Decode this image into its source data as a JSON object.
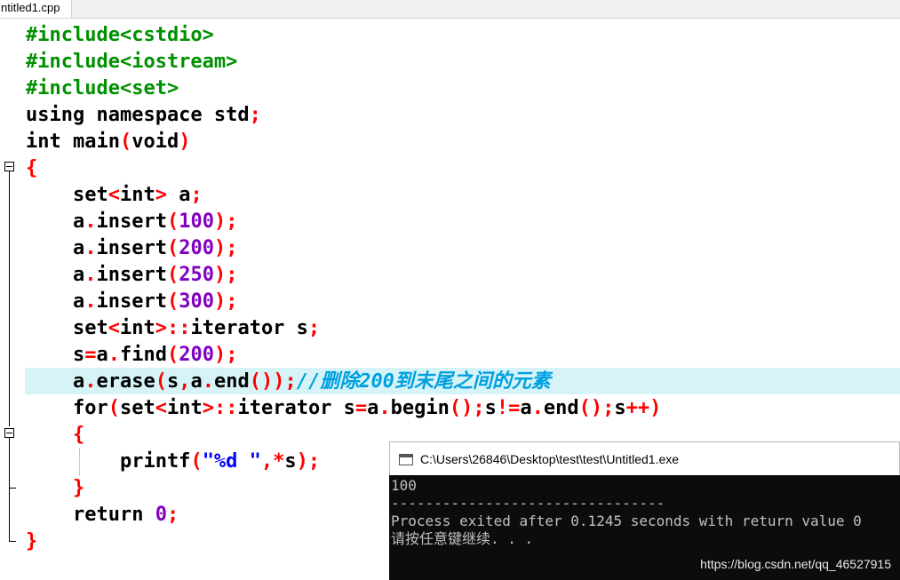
{
  "tab": {
    "label": "ntitled1.cpp"
  },
  "code_lines": [
    [
      {
        "t": "#include<cstdio>",
        "c": "pp"
      }
    ],
    [
      {
        "t": "#include<iostream>",
        "c": "pp"
      }
    ],
    [
      {
        "t": "#include<set>",
        "c": "pp"
      }
    ],
    [
      {
        "t": "using namespace ",
        "c": "kw"
      },
      {
        "t": "std",
        "c": "id"
      },
      {
        "t": ";",
        "c": "op"
      }
    ],
    [
      {
        "t": "int ",
        "c": "kw"
      },
      {
        "t": "main",
        "c": "id"
      },
      {
        "t": "(",
        "c": "op"
      },
      {
        "t": "void",
        "c": "kw"
      },
      {
        "t": ")",
        "c": "op"
      }
    ],
    [
      {
        "t": "{",
        "c": "op"
      }
    ],
    [
      {
        "t": "    set",
        "c": "id"
      },
      {
        "t": "<",
        "c": "op"
      },
      {
        "t": "int",
        "c": "kw"
      },
      {
        "t": "> ",
        "c": "op"
      },
      {
        "t": "a",
        "c": "id"
      },
      {
        "t": ";",
        "c": "op"
      }
    ],
    [
      {
        "t": "    a",
        "c": "id"
      },
      {
        "t": ".",
        "c": "op"
      },
      {
        "t": "insert",
        "c": "id"
      },
      {
        "t": "(",
        "c": "op"
      },
      {
        "t": "100",
        "c": "num"
      },
      {
        "t": ");",
        "c": "op"
      }
    ],
    [
      {
        "t": "    a",
        "c": "id"
      },
      {
        "t": ".",
        "c": "op"
      },
      {
        "t": "insert",
        "c": "id"
      },
      {
        "t": "(",
        "c": "op"
      },
      {
        "t": "200",
        "c": "num"
      },
      {
        "t": ");",
        "c": "op"
      }
    ],
    [
      {
        "t": "    a",
        "c": "id"
      },
      {
        "t": ".",
        "c": "op"
      },
      {
        "t": "insert",
        "c": "id"
      },
      {
        "t": "(",
        "c": "op"
      },
      {
        "t": "250",
        "c": "num"
      },
      {
        "t": ");",
        "c": "op"
      }
    ],
    [
      {
        "t": "    a",
        "c": "id"
      },
      {
        "t": ".",
        "c": "op"
      },
      {
        "t": "insert",
        "c": "id"
      },
      {
        "t": "(",
        "c": "op"
      },
      {
        "t": "300",
        "c": "num"
      },
      {
        "t": ");",
        "c": "op"
      }
    ],
    [
      {
        "t": "    set",
        "c": "id"
      },
      {
        "t": "<",
        "c": "op"
      },
      {
        "t": "int",
        "c": "kw"
      },
      {
        "t": ">::",
        "c": "op"
      },
      {
        "t": "iterator s",
        "c": "id"
      },
      {
        "t": ";",
        "c": "op"
      }
    ],
    [
      {
        "t": "    s",
        "c": "id"
      },
      {
        "t": "=",
        "c": "op"
      },
      {
        "t": "a",
        "c": "id"
      },
      {
        "t": ".",
        "c": "op"
      },
      {
        "t": "find",
        "c": "id"
      },
      {
        "t": "(",
        "c": "op"
      },
      {
        "t": "200",
        "c": "num"
      },
      {
        "t": ");",
        "c": "op"
      }
    ],
    [
      {
        "t": "    a",
        "c": "id"
      },
      {
        "t": ".",
        "c": "op"
      },
      {
        "t": "erase",
        "c": "id"
      },
      {
        "t": "(",
        "c": "op"
      },
      {
        "t": "s",
        "c": "id"
      },
      {
        "t": ",",
        "c": "op"
      },
      {
        "t": "a",
        "c": "id"
      },
      {
        "t": ".",
        "c": "op"
      },
      {
        "t": "end",
        "c": "id"
      },
      {
        "t": "());",
        "c": "op"
      },
      {
        "t": "//删除200到末尾之间的元素",
        "c": "cm"
      }
    ],
    [
      {
        "t": "    for",
        "c": "kw"
      },
      {
        "t": "(",
        "c": "op"
      },
      {
        "t": "set",
        "c": "id"
      },
      {
        "t": "<",
        "c": "op"
      },
      {
        "t": "int",
        "c": "kw"
      },
      {
        "t": ">::",
        "c": "op"
      },
      {
        "t": "iterator s",
        "c": "id"
      },
      {
        "t": "=",
        "c": "op"
      },
      {
        "t": "a",
        "c": "id"
      },
      {
        "t": ".",
        "c": "op"
      },
      {
        "t": "begin",
        "c": "id"
      },
      {
        "t": "();",
        "c": "op"
      },
      {
        "t": "s",
        "c": "id"
      },
      {
        "t": "!=",
        "c": "op"
      },
      {
        "t": "a",
        "c": "id"
      },
      {
        "t": ".",
        "c": "op"
      },
      {
        "t": "end",
        "c": "id"
      },
      {
        "t": "();",
        "c": "op"
      },
      {
        "t": "s",
        "c": "id"
      },
      {
        "t": "++)",
        "c": "op"
      }
    ],
    [
      {
        "t": "    {",
        "c": "op"
      }
    ],
    [
      {
        "t": "        printf",
        "c": "id"
      },
      {
        "t": "(",
        "c": "op"
      },
      {
        "t": "\"%d \"",
        "c": "str"
      },
      {
        "t": ",*",
        "c": "op"
      },
      {
        "t": "s",
        "c": "id"
      },
      {
        "t": ");",
        "c": "op"
      }
    ],
    [
      {
        "t": "    }",
        "c": "op"
      }
    ],
    [
      {
        "t": "    return ",
        "c": "kw"
      },
      {
        "t": "0",
        "c": "num"
      },
      {
        "t": ";",
        "c": "op"
      }
    ],
    [
      {
        "t": "}",
        "c": "op"
      }
    ]
  ],
  "console": {
    "title": "C:\\Users\\26846\\Desktop\\test\\test\\Untitled1.exe",
    "output": "100\n--------------------------------\nProcess exited after 0.1245 seconds with return value 0\n请按任意键继续. . ."
  },
  "watermark": "https://blog.csdn.net/qq_46527915"
}
